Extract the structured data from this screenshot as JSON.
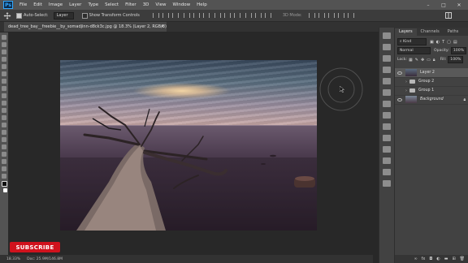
{
  "menubar": {
    "logo": "Ps",
    "items": [
      "File",
      "Edit",
      "Image",
      "Layer",
      "Type",
      "Select",
      "Filter",
      "3D",
      "View",
      "Window",
      "Help"
    ],
    "minimize": "–",
    "maximize": "□",
    "close": "✕"
  },
  "options_bar": {
    "auto_select_label": "Auto-Select:",
    "auto_select_value": "Layer",
    "transform_label": "Show Transform Controls",
    "mode_label": "3D Mode:"
  },
  "document_tab": {
    "title": "dead_tree_bay__freebie__by_somadjinn-d8ck3c.jpg @ 18.3% (Layer 2, RGB/8)",
    "close": "✕"
  },
  "subscribe_label": "SUBSCRIBE",
  "status": {
    "zoom": "18.33%",
    "doc": "Doc: 25.9M/146.8M"
  },
  "panel": {
    "tabs": [
      "Layers",
      "Channels",
      "Paths"
    ],
    "kind_label": "Kind",
    "blend_mode": "Normal",
    "opacity_label": "Opacity:",
    "opacity_value": "100%",
    "lock_label": "Lock:",
    "fill_label": "Fill:",
    "fill_value": "100%",
    "layers": [
      {
        "name": "Layer 2",
        "type": "pixel",
        "selected": true
      },
      {
        "name": "Group 2",
        "type": "group",
        "selected": false
      },
      {
        "name": "Group 1",
        "type": "group",
        "selected": false
      },
      {
        "name": "Background",
        "type": "background",
        "selected": false
      }
    ]
  },
  "colors": {
    "accent": "#31a8ff",
    "subscribe_red": "#d0121d",
    "app_bg": "#282828"
  }
}
